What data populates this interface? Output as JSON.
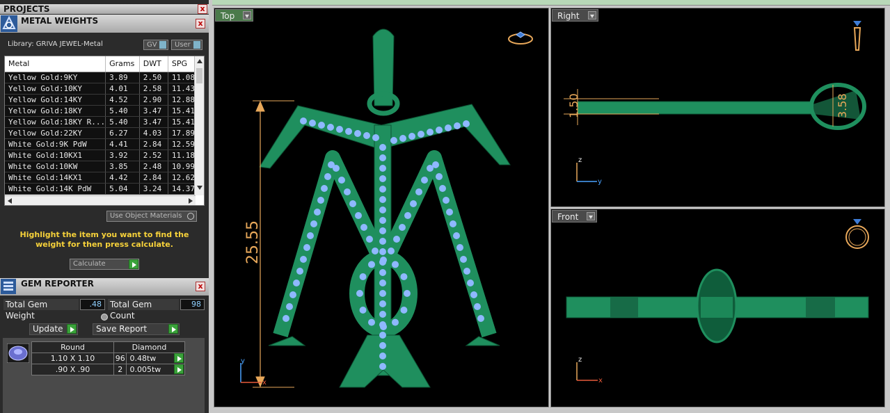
{
  "projects": {
    "title": "PROJECTS",
    "close": "x"
  },
  "metal_weights": {
    "title": "METAL WEIGHTS",
    "close": "x",
    "library": "Library: GRIVA JEWEL-Metal",
    "gv_label": "GV",
    "user_label": "User",
    "columns": [
      "Metal",
      "Grams",
      "DWT",
      "SPG"
    ],
    "rows": [
      [
        "Yellow Gold:9KY",
        "3.89",
        "2.50",
        "11.08"
      ],
      [
        "Yellow Gold:10KY",
        "4.01",
        "2.58",
        "11.43"
      ],
      [
        "Yellow Gold:14KY",
        "4.52",
        "2.90",
        "12.88"
      ],
      [
        "Yellow Gold:18KY",
        "5.40",
        "3.47",
        "15.41"
      ],
      [
        "Yellow Gold:18KY R...",
        "5.40",
        "3.47",
        "15.41"
      ],
      [
        "Yellow Gold:22KY",
        "6.27",
        "4.03",
        "17.89"
      ],
      [
        "White Gold:9K PdW",
        "4.41",
        "2.84",
        "12.59"
      ],
      [
        "White Gold:10KX1",
        "3.92",
        "2.52",
        "11.18"
      ],
      [
        "White Gold:10KW",
        "3.85",
        "2.48",
        "10.99"
      ],
      [
        "White Gold:14KX1",
        "4.42",
        "2.84",
        "12.62"
      ],
      [
        "White Gold:14K PdW",
        "5.04",
        "3.24",
        "14.37"
      ]
    ],
    "use_object_materials": "Use Object Materials",
    "hint": "Highlight the item you want to find the weight for then press calculate.",
    "calculate": "Calculate"
  },
  "gem_reporter": {
    "title": "GEM REPORTER",
    "close": "x",
    "total_weight_label": "Total Gem Weight",
    "total_weight": ".48",
    "total_count_label": "Total Gem Count",
    "total_count": "98",
    "update": "Update",
    "save_report": "Save Report",
    "shape": "Round",
    "material": "Diamond",
    "gems": [
      {
        "size": "1.10 X 1.10",
        "count": "96",
        "weight": "0.48tw"
      },
      {
        "size": ".90 X .90",
        "count": "2",
        "weight": "0.005tw"
      }
    ]
  },
  "viewports": {
    "top": {
      "label": "Top",
      "dim_height": "25.55",
      "axis_y": "y",
      "axis_x": "x"
    },
    "right": {
      "label": "Right",
      "dim_a": "1.50",
      "dim_b": "3.58",
      "axis_z": "z",
      "axis_y": "y"
    },
    "front": {
      "label": "Front",
      "axis_z": "z",
      "axis_x": "x"
    }
  },
  "colors": {
    "model": "#1f8f5e",
    "dim": "#e8a85a",
    "gem": "#8fb8ff",
    "accent_yellow": "#f7d23a"
  }
}
